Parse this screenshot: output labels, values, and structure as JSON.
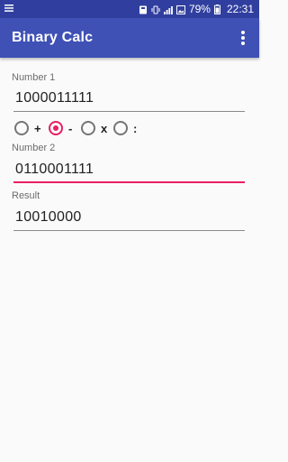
{
  "status_bar": {
    "left_icon": "list-icon",
    "battery_percent": "79%",
    "time": "22:31",
    "icons": [
      "storage-icon",
      "vibrate-icon",
      "signal-icon",
      "picture-icon",
      "battery-icon"
    ]
  },
  "app_bar": {
    "title": "Binary Calc",
    "menu_icon": "overflow-menu-icon"
  },
  "form": {
    "number1_label": "Number 1",
    "number1_value": "1000011111",
    "operations": [
      {
        "label": "+",
        "checked": false
      },
      {
        "label": "-",
        "checked": true
      },
      {
        "label": "x",
        "checked": false
      },
      {
        "label": ":",
        "checked": false
      }
    ],
    "number2_label": "Number 2",
    "number2_value": "0110001111",
    "result_label": "Result",
    "result_value": "10010000"
  },
  "colors": {
    "primary": "#3f51b5",
    "primary_dark": "#303f9f",
    "accent": "#e91e63"
  }
}
